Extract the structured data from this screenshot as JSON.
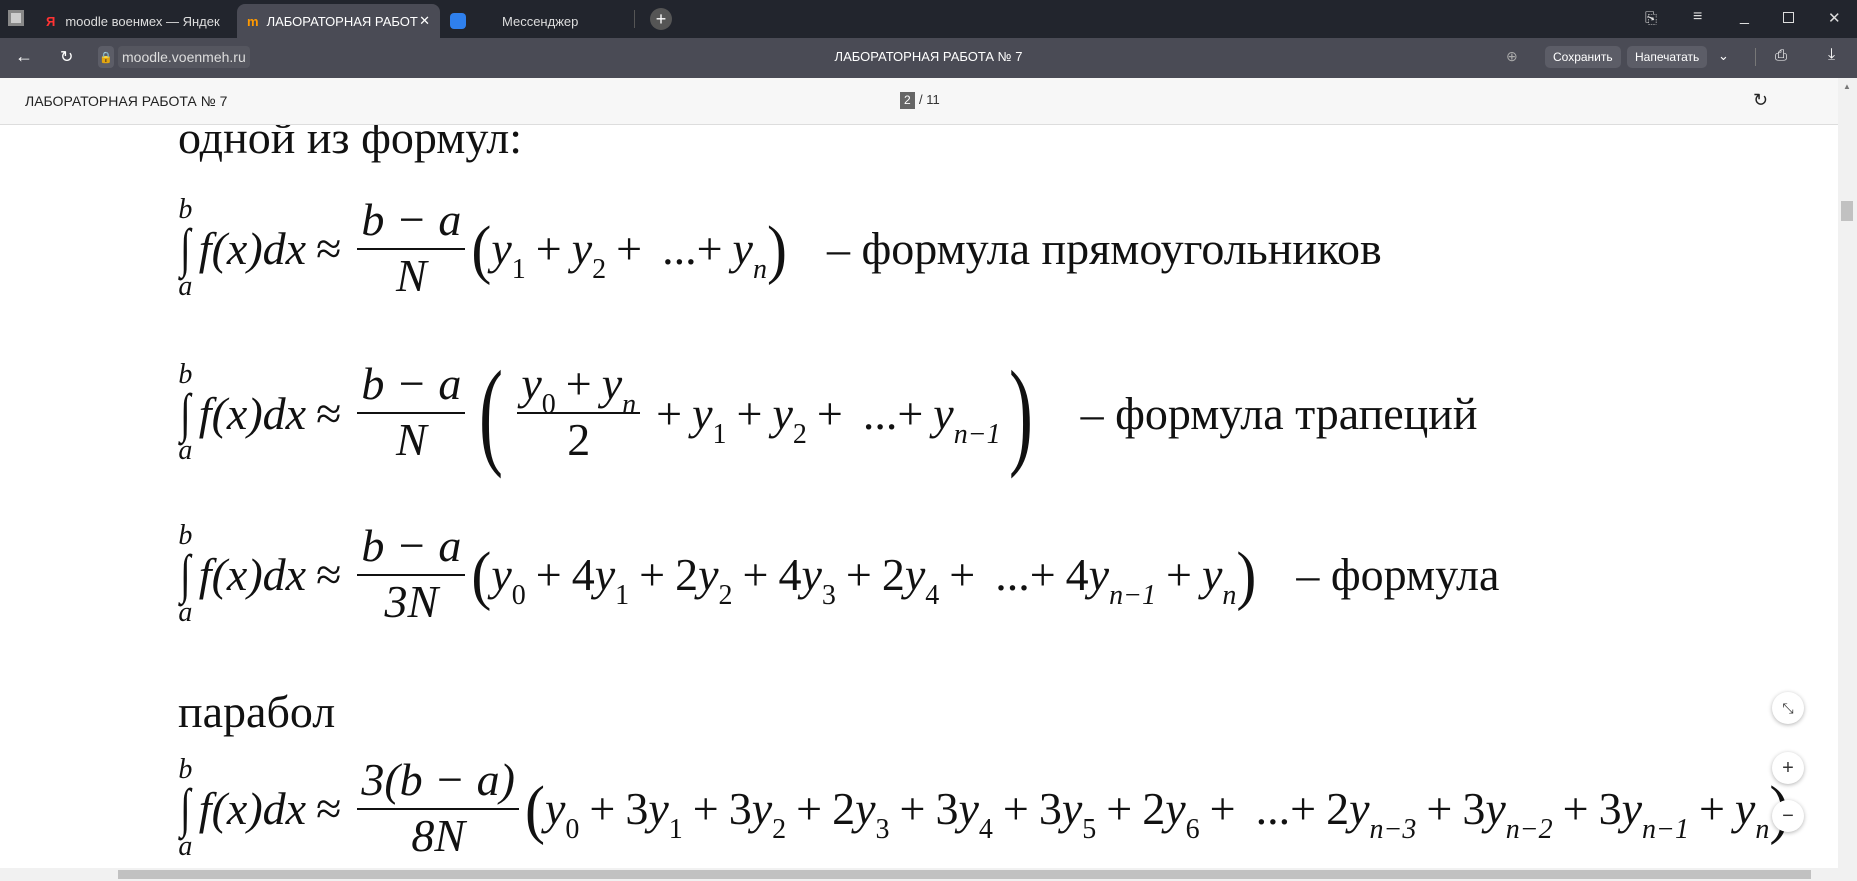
{
  "tabs": [
    {
      "label": "moodle военмех — Яндек",
      "icon": "yandex-icon"
    },
    {
      "label": "ЛАБОРАТОРНАЯ РАБОТ",
      "icon": "moodle-icon",
      "active": true
    },
    {
      "label": "Мессенджер",
      "icon": "messenger-icon"
    }
  ],
  "toolbar": {
    "url": "moodle.voenmeh.ru",
    "title": "ЛАБОРАТОРНАЯ РАБОТА № 7",
    "save_label": "Сохранить",
    "print_label": "Напечатать"
  },
  "pdf": {
    "title": "ЛАБОРАТОРНАЯ РАБОТА № 7",
    "current_page": "2",
    "total_pages": "/ 11"
  },
  "doc": {
    "intro": "одной из формул:",
    "between": "парабол",
    "formulas": [
      {
        "upper": "b",
        "lower": "a",
        "integrand": "f(x)dx",
        "approx": "≈",
        "num": "b − a",
        "den": "N",
        "body": [
          {
            "v": "y",
            "s": "1"
          },
          {
            "o": "+"
          },
          {
            "v": "y",
            "s": "2"
          },
          {
            "o": "+"
          },
          {
            "o": "...+"
          },
          {
            "v": "y",
            "s": "n"
          }
        ],
        "label": "– формула прямоугольников"
      },
      {
        "upper": "b",
        "lower": "a",
        "integrand": "f(x)dx",
        "approx": "≈",
        "num": "b − a",
        "den": "N",
        "inner_num": [
          {
            "v": "y",
            "s": "0"
          },
          {
            "o": "+"
          },
          {
            "v": "y",
            "s": "n"
          }
        ],
        "inner_den": "2",
        "body": [
          {
            "o": "+"
          },
          {
            "v": "y",
            "s": "1"
          },
          {
            "o": "+"
          },
          {
            "v": "y",
            "s": "2"
          },
          {
            "o": "+"
          },
          {
            "o": "...+"
          },
          {
            "v": "y",
            "s": "n−1"
          }
        ],
        "label": "– формула трапеций"
      },
      {
        "upper": "b",
        "lower": "a",
        "integrand": "f(x)dx",
        "approx": "≈",
        "num": "b − a",
        "den": "3N",
        "body": [
          {
            "v": "y",
            "s": "0"
          },
          {
            "o": "+"
          },
          {
            "c": "4"
          },
          {
            "v": "y",
            "s": "1"
          },
          {
            "o": "+"
          },
          {
            "c": "2"
          },
          {
            "v": "y",
            "s": "2"
          },
          {
            "o": "+"
          },
          {
            "c": "4"
          },
          {
            "v": "y",
            "s": "3"
          },
          {
            "o": "+"
          },
          {
            "c": "2"
          },
          {
            "v": "y",
            "s": "4"
          },
          {
            "o": "+"
          },
          {
            "o": "...+"
          },
          {
            "c": "4"
          },
          {
            "v": "y",
            "s": "n−1"
          },
          {
            "o": "+"
          },
          {
            "v": "y",
            "s": "n"
          }
        ],
        "label": "– формула"
      },
      {
        "upper": "b",
        "lower": "a",
        "integrand": "f(x)dx",
        "approx": "≈",
        "num": "3(b − a)",
        "den": "8N",
        "body": [
          {
            "v": "y",
            "s": "0"
          },
          {
            "o": "+"
          },
          {
            "c": "3"
          },
          {
            "v": "y",
            "s": "1"
          },
          {
            "o": "+"
          },
          {
            "c": "3"
          },
          {
            "v": "y",
            "s": "2"
          },
          {
            "o": "+"
          },
          {
            "c": "2"
          },
          {
            "v": "y",
            "s": "3"
          },
          {
            "o": "+"
          },
          {
            "c": "3"
          },
          {
            "v": "y",
            "s": "4"
          },
          {
            "o": "+"
          },
          {
            "c": "3"
          },
          {
            "v": "y",
            "s": "5"
          },
          {
            "o": "+"
          },
          {
            "c": "2"
          },
          {
            "v": "y",
            "s": "6"
          },
          {
            "o": "+"
          },
          {
            "o": "...+"
          },
          {
            "c": "2"
          },
          {
            "v": "y",
            "s": "n−3"
          },
          {
            "o": "+"
          },
          {
            "c": "3"
          },
          {
            "v": "y",
            "s": "n−2"
          },
          {
            "o": "+"
          },
          {
            "c": "3"
          },
          {
            "v": "y",
            "s": "n−1"
          },
          {
            "o": "+"
          },
          {
            "v": "y",
            "s": "n"
          }
        ],
        "label": ""
      }
    ]
  },
  "zoom_controls": {
    "fit": "⤡",
    "plus": "+",
    "minus": "−"
  }
}
